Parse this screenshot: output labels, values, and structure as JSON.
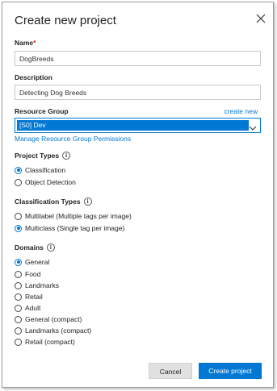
{
  "dialog": {
    "title": "Create new project",
    "close_icon": "close-icon"
  },
  "name": {
    "label": "Name",
    "required_mark": "*",
    "value": "DogBreeds"
  },
  "description": {
    "label": "Description",
    "value": "Detecting Dog Breeds"
  },
  "resource_group": {
    "label": "Resource Group",
    "create_link": "create new",
    "selected": "[S0] Dev",
    "manage_link": "Manage Resource Group Permissions",
    "chevron_icon": "chevron-down-icon"
  },
  "project_types": {
    "label": "Project Types",
    "info_icon": "info-icon",
    "info_glyph": "i",
    "options": [
      {
        "label": "Classification",
        "selected": true
      },
      {
        "label": "Object Detection",
        "selected": false
      }
    ]
  },
  "classification_types": {
    "label": "Classification Types",
    "info_icon": "info-icon",
    "info_glyph": "i",
    "options": [
      {
        "label": "Multilabel (Multiple tags per image)",
        "selected": false
      },
      {
        "label": "Multiclass (Single tag per image)",
        "selected": true
      }
    ]
  },
  "domains": {
    "label": "Domains",
    "info_icon": "info-icon",
    "info_glyph": "i",
    "options": [
      {
        "label": "General",
        "selected": true
      },
      {
        "label": "Food",
        "selected": false
      },
      {
        "label": "Landmarks",
        "selected": false
      },
      {
        "label": "Retail",
        "selected": false
      },
      {
        "label": "Adult",
        "selected": false
      },
      {
        "label": "General (compact)",
        "selected": false
      },
      {
        "label": "Landmarks (compact)",
        "selected": false
      },
      {
        "label": "Retail (compact)",
        "selected": false
      }
    ]
  },
  "footer": {
    "cancel_label": "Cancel",
    "create_label": "Create project"
  },
  "colors": {
    "accent": "#0078d4",
    "required": "#e81123"
  }
}
